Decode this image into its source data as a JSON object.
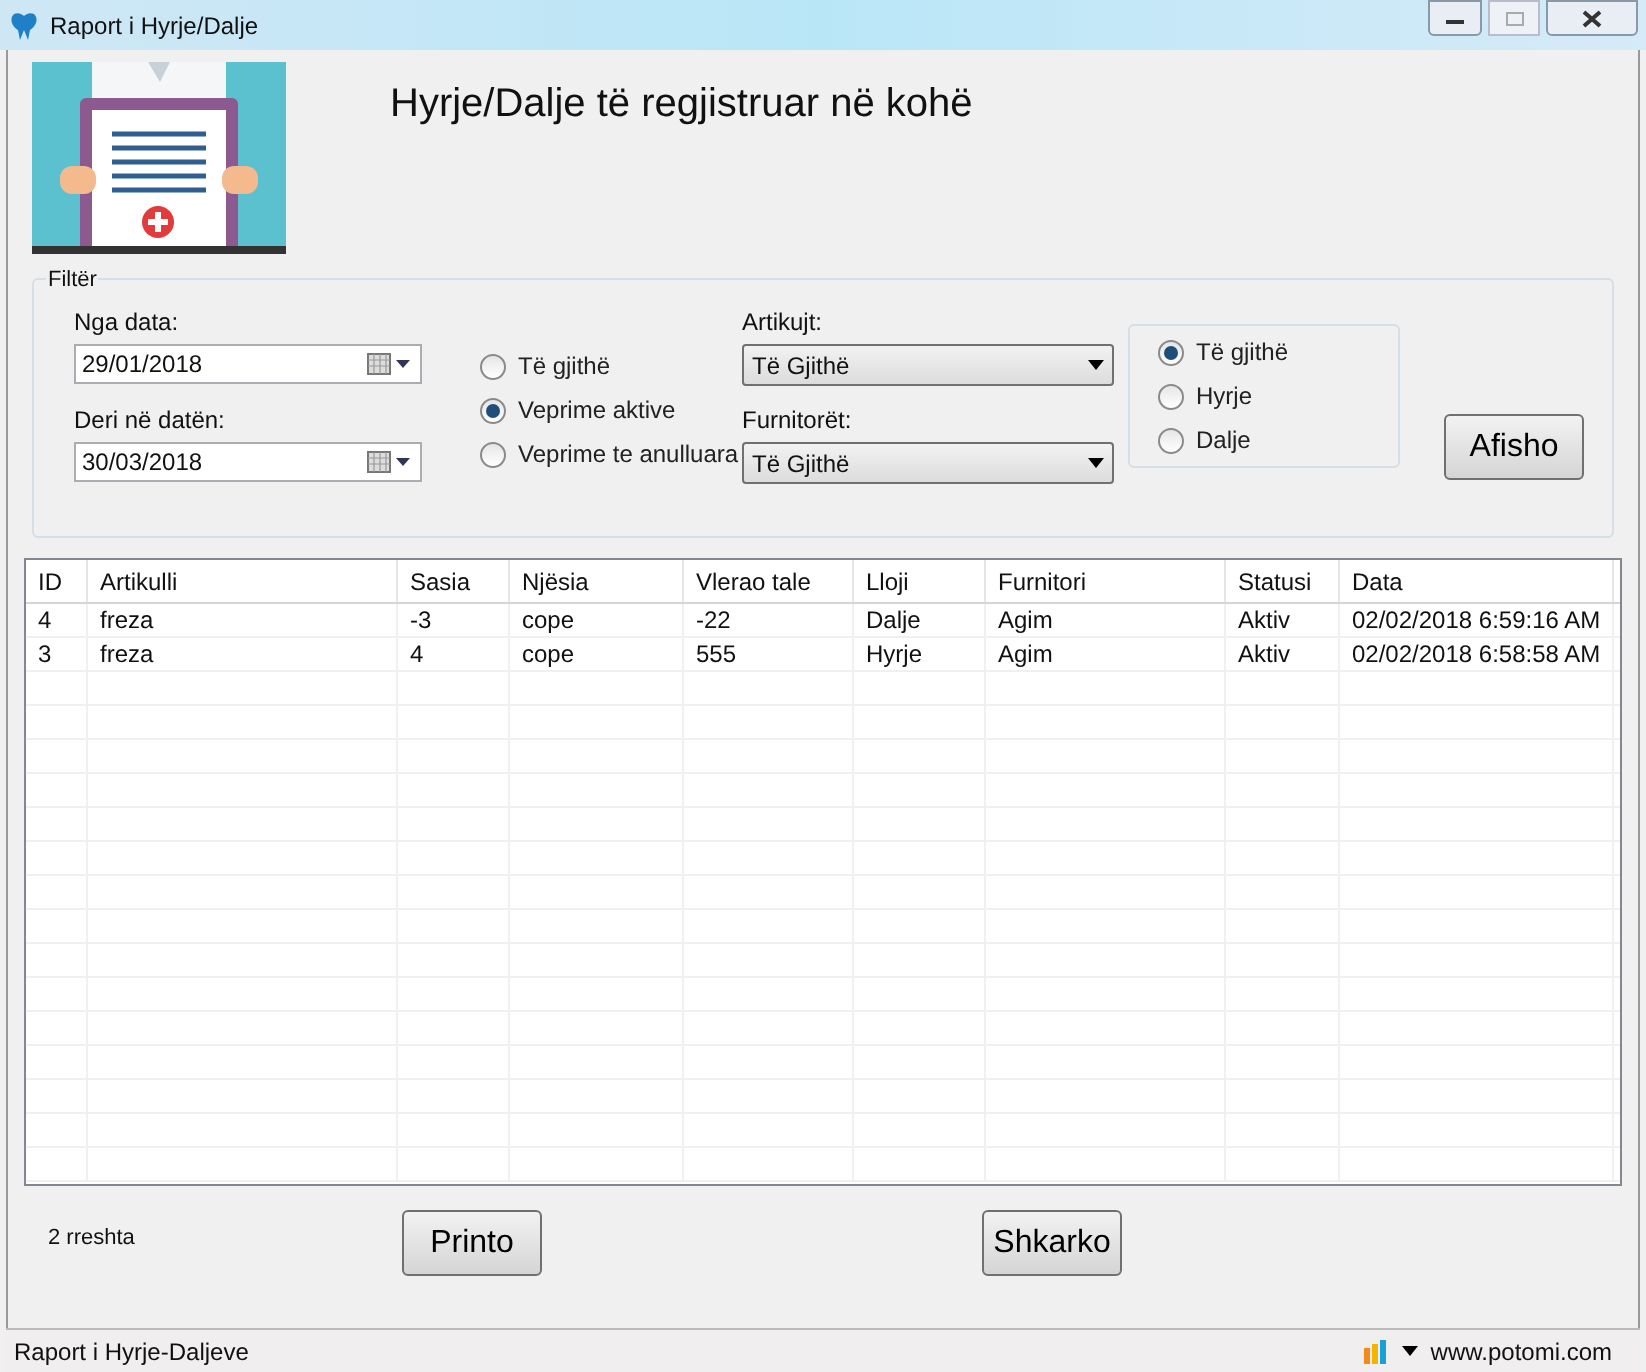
{
  "window": {
    "title": "Raport i Hyrje/Dalje"
  },
  "heading": "Hyrje/Dalje të regjistruar në kohë",
  "filter": {
    "title": "Filtër",
    "from": {
      "label": "Nga data:",
      "value": "29/01/2018"
    },
    "to": {
      "label": "Deri në datën:",
      "value": "30/03/2018"
    },
    "status_options": [
      {
        "label": "Të gjithë",
        "selected": false
      },
      {
        "label": "Veprime aktive",
        "selected": true
      },
      {
        "label": "Veprime te anulluara",
        "selected": false
      }
    ],
    "items": {
      "label": "Artikujt:",
      "value": "Të Gjithë"
    },
    "suppliers": {
      "label": "Furnitorët:",
      "value": "Të Gjithë"
    },
    "type_options": [
      {
        "label": "Të gjithë",
        "selected": true
      },
      {
        "label": "Hyrje",
        "selected": false
      },
      {
        "label": "Dalje",
        "selected": false
      }
    ],
    "button": "Afisho"
  },
  "table": {
    "columns": [
      "ID",
      "Artikulli",
      "Sasia",
      "Njësia",
      "Vlerao tale",
      "Lloji",
      "Furnitori",
      "Statusi",
      "Data"
    ],
    "rows": [
      [
        "4",
        "freza",
        "-3",
        "cope",
        "-22",
        "Dalje",
        "Agim",
        "Aktiv",
        "02/02/2018 6:59:16 AM"
      ],
      [
        "3",
        "freza",
        "4",
        "cope",
        "555",
        "Hyrje",
        "Agim",
        "Aktiv",
        "02/02/2018 6:58:58 AM"
      ]
    ]
  },
  "row_count": "2 rreshta",
  "buttons": [
    "Printo",
    "Shkarko"
  ],
  "status_bar": {
    "text": "Raport i Hyrje-Daljeve",
    "link": "www.potomi.com"
  }
}
